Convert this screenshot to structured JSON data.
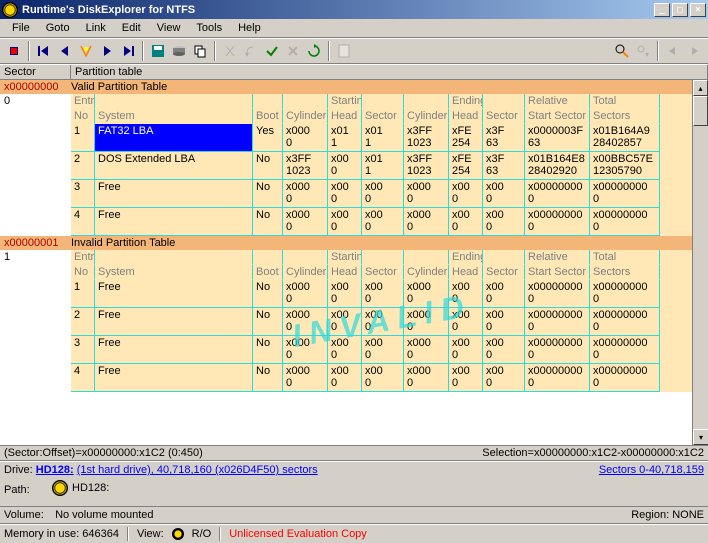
{
  "window": {
    "title": "Runtime's DiskExplorer for NTFS",
    "buttons": {
      "min": "_",
      "max": "□",
      "close": "×"
    }
  },
  "menu": [
    "File",
    "Goto",
    "Link",
    "Edit",
    "View",
    "Tools",
    "Help"
  ],
  "header": {
    "sector": "Sector",
    "partition": "Partition table"
  },
  "sections": [
    {
      "addr": "x00000000",
      "title": "Valid Partition Table",
      "sector_num": "0",
      "valid": true,
      "entries": [
        {
          "no": "1",
          "sys": "FAT32 LBA",
          "selected": true,
          "boot": "Yes",
          "scyl": "x000 0",
          "shead": "x01 1",
          "ssec": "x01 1",
          "ecyl": "x3FF 1023",
          "ehead": "xFE 254",
          "esec": "x3F 63",
          "rel": "x0000003F 63",
          "tot": "x01B164A9 28402857"
        },
        {
          "no": "2",
          "sys": "DOS Extended LBA",
          "boot": "No",
          "scyl": "x3FF 1023",
          "shead": "x00 0",
          "ssec": "x01 1",
          "ecyl": "x3FF 1023",
          "ehead": "xFE 254",
          "esec": "x3F 63",
          "rel": "x01B164E8 28402920",
          "tot": "x00BBC57E 12305790"
        },
        {
          "no": "3",
          "sys": "Free",
          "boot": "No",
          "scyl": "x000 0",
          "shead": "x00 0",
          "ssec": "x00 0",
          "ecyl": "x000 0",
          "ehead": "x00 0",
          "esec": "x00 0",
          "rel": "x00000000 0",
          "tot": "x00000000 0"
        },
        {
          "no": "4",
          "sys": "Free",
          "boot": "No",
          "scyl": "x000 0",
          "shead": "x00 0",
          "ssec": "x00 0",
          "ecyl": "x000 0",
          "ehead": "x00 0",
          "esec": "x00 0",
          "rel": "x00000000 0",
          "tot": "x00000000 0"
        }
      ]
    },
    {
      "addr": "x00000001",
      "title": "Invalid Partition Table",
      "sector_num": "1",
      "valid": false,
      "entries": [
        {
          "no": "1",
          "sys": "Free",
          "boot": "No",
          "scyl": "x000 0",
          "shead": "x00 0",
          "ssec": "x00 0",
          "ecyl": "x000 0",
          "ehead": "x00 0",
          "esec": "x00 0",
          "rel": "x00000000 0",
          "tot": "x00000000 0"
        },
        {
          "no": "2",
          "sys": "Free",
          "boot": "No",
          "scyl": "x000 0",
          "shead": "x00 0",
          "ssec": "x00 0",
          "ecyl": "x000 0",
          "ehead": "x00 0",
          "esec": "x00 0",
          "rel": "x00000000 0",
          "tot": "x00000000 0"
        },
        {
          "no": "3",
          "sys": "Free",
          "boot": "No",
          "scyl": "x000 0",
          "shead": "x00 0",
          "ssec": "x00 0",
          "ecyl": "x000 0",
          "ehead": "x00 0",
          "esec": "x00 0",
          "rel": "x00000000 0",
          "tot": "x00000000 0"
        },
        {
          "no": "4",
          "sys": "Free",
          "boot": "No",
          "scyl": "x000 0",
          "shead": "x00 0",
          "ssec": "x00 0",
          "ecyl": "x000 0",
          "ehead": "x00 0",
          "esec": "x00 0",
          "rel": "x00000000 0",
          "tot": "x00000000 0"
        }
      ]
    }
  ],
  "col_headers": {
    "entry_no": "Entry No",
    "system": "System",
    "boot": "Boot",
    "starting": "Starting",
    "ending": "Ending",
    "cylinder": "Cylinder",
    "head": "Head",
    "sector": "Sector",
    "relative": "Relative Start Sector",
    "total": "Total Sectors"
  },
  "watermark": "INVALID",
  "status": {
    "offset": "(Sector:Offset)=x00000000:x1C2 (0:450)",
    "selection": "Selection=x00000000:x1C2-x00000000:x1C2"
  },
  "drive": {
    "label": "Drive:",
    "name": "HD128:",
    "desc": "(1st hard drive), 40,718,160 (x026D4F50) sectors",
    "sectors": "Sectors 0-40,718,159"
  },
  "path": {
    "label": "Path:",
    "value": "HD128:"
  },
  "volume": {
    "label": "Volume:",
    "value": "No volume mounted",
    "region_lbl": "Region:",
    "region": "NONE"
  },
  "bottom": {
    "memory": "Memory in use: 646364",
    "view": "View:",
    "ro": "R/O",
    "unlicensed": "Unlicensed Evaluation Copy"
  }
}
